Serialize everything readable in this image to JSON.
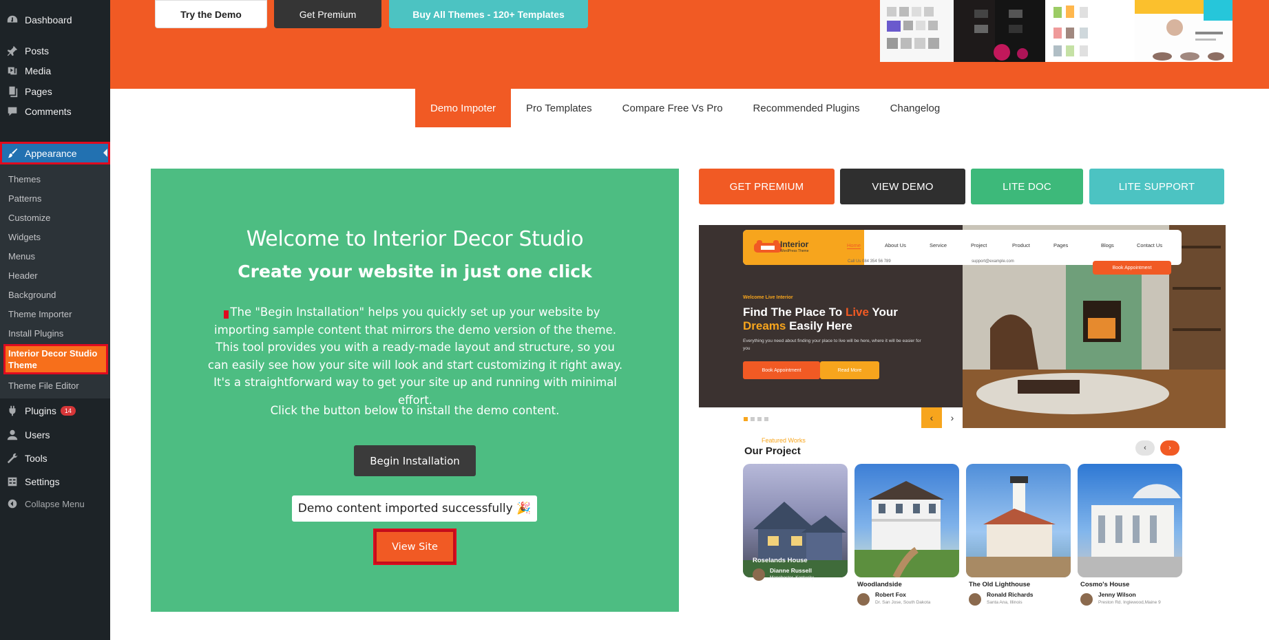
{
  "sidebar": {
    "items": [
      {
        "label": "Dashboard",
        "icon": "dashboard-icon"
      },
      {
        "label": "Posts",
        "icon": "pin-icon"
      },
      {
        "label": "Media",
        "icon": "media-icon"
      },
      {
        "label": "Pages",
        "icon": "pages-icon"
      },
      {
        "label": "Comments",
        "icon": "comment-icon"
      },
      {
        "label": "Appearance",
        "icon": "paintbrush-icon"
      }
    ],
    "submenu": [
      "Themes",
      "Patterns",
      "Customize",
      "Widgets",
      "Menus",
      "Header",
      "Background",
      "Theme Importer",
      "Install Plugins",
      "Interior Decor Studio Theme",
      "Theme File Editor"
    ],
    "lower_items": [
      {
        "label": "Plugins",
        "icon": "plugin-icon",
        "badge": "14"
      },
      {
        "label": "Users",
        "icon": "users-icon"
      },
      {
        "label": "Tools",
        "icon": "wrench-icon"
      },
      {
        "label": "Settings",
        "icon": "settings-icon"
      }
    ],
    "collapse_label": "Collapse Menu"
  },
  "hero": {
    "try_demo": "Try the Demo",
    "get_premium": "Get Premium",
    "buy_all": "Buy All Themes - 120+ Templates"
  },
  "tabs": [
    "Demo Impoter",
    "Pro Templates",
    "Compare Free Vs Pro",
    "Recommended Plugins",
    "Changelog"
  ],
  "welcome": {
    "title": "Welcome to Interior Decor Studio",
    "subtitle": "Create your website in just one click",
    "description": "The \"Begin Installation\" helps you quickly set up your website by importing sample content that mirrors the demo version of the theme. This tool provides you with a ready-made layout and structure, so you can easily see how your site will look and start customizing it right away. It's a straightforward way to get your site up and running with minimal effort.",
    "click_text": "Click the button below to install the demo content.",
    "begin_button": "Begin Installation",
    "success_message": "Demo content imported successfully 🎉",
    "view_site": "View Site"
  },
  "actions": [
    "GET PREMIUM",
    "VIEW DEMO",
    "LITE DOC",
    "LITE SUPPORT"
  ],
  "preview": {
    "logo": "Interior",
    "logo_sub": "WordPress Theme",
    "nav": [
      "Home",
      "About Us",
      "Service",
      "Project",
      "Product",
      "Pages",
      "Blogs",
      "Contact Us"
    ],
    "phone": "Call Us 084 354 56 789",
    "email": "support@example.com",
    "book_top": "Book Appointment",
    "kicker": "Welcome Live Interior",
    "headline_1": "Find The Place To ",
    "headline_live": "Live",
    "headline_2": " Your",
    "headline_dreams": "Dreams",
    "headline_3": " Easily Here",
    "sub": "Everything you need about finding your place to live will be here, where it will be easier for you",
    "btn_book": "Book Appointment",
    "btn_read": "Read More",
    "featured": "Featured Works",
    "our_project": "Our Project",
    "cards": [
      {
        "title": "Roselands House",
        "person": "Dianne Russell",
        "location": "Manchester, Kentucky"
      },
      {
        "title": "Woodlandside",
        "person": "Robert Fox",
        "location": "Dr. San Jose, South Dakota"
      },
      {
        "title": "The Old Lighthouse",
        "person": "Ronald Richards",
        "location": "Santa Ana, Illinois"
      },
      {
        "title": "Cosmo's House",
        "person": "Jenny Wilson",
        "location": "Preston Rd. Inglewood,Maine 9"
      }
    ]
  },
  "colors": {
    "brand_orange": "#f15a24",
    "brand_green": "#4dbd82",
    "brand_teal": "#4cc3c2",
    "wp_sidebar": "#1d2327",
    "wp_blue": "#2271b1",
    "highlight_red": "#e00b1f"
  }
}
